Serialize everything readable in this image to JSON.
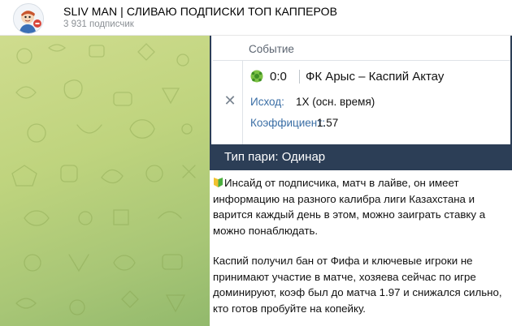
{
  "channel": {
    "title": "SLIV MAN | СЛИВАЮ ПОДПИСКИ ТОП КАППЕРОВ",
    "subscribers": "3 931 подписчик"
  },
  "bet": {
    "event_label": "Событие",
    "score": "0:0",
    "teams": "ФК Арыс – Каспий Актау",
    "outcome_label": "Исход:",
    "outcome_value": "1Х (осн. время)",
    "coef_label": "Коэффициент:",
    "coef_value": "1.57",
    "bet_type": "Тип пари: Одинар"
  },
  "message": {
    "paragraph1": "Инсайд от подписчика, матч в лайве, он имеет информацию на разного калибра лиги Казахстана и варится каждый день в этом, можно заиграть ставку а можно понаблюдать.",
    "paragraph2": "Каспий получил бан от Фифа и ключевые игроки не принимают участие в матче, хозяева сейчас по игре доминируют, коэф был до матча 1.97 и снижался сильно, кто готов пробуйте на копейку."
  },
  "icons": {
    "avatar": "channel-avatar",
    "ball": "soccer-ball-icon",
    "remove": "close-icon",
    "shield": "beginner-shield-icon"
  },
  "colors": {
    "dark_panel": "#2c3e56",
    "label_blue": "#3a6ea5",
    "wallpaper": "#bfd47e"
  }
}
